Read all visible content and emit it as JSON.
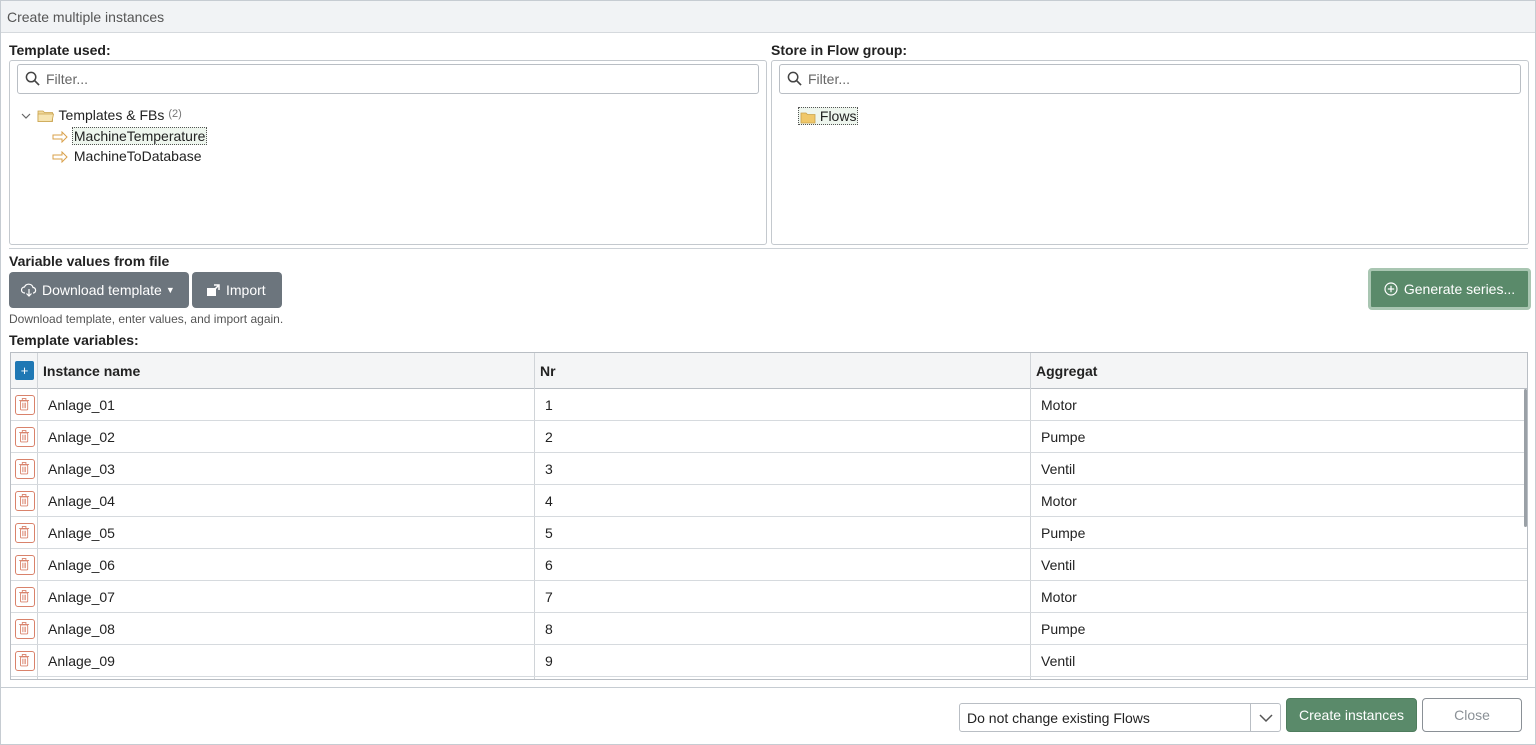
{
  "dialog": {
    "title": "Create multiple instances"
  },
  "template_section": {
    "label": "Template used:",
    "filter_placeholder": "Filter...",
    "tree": {
      "root_label": "Templates & FBs",
      "root_count": "(2)",
      "items": [
        "MachineTemperature",
        "MachineToDatabase"
      ],
      "selected": "MachineTemperature"
    }
  },
  "flow_section": {
    "label": "Store in Flow group:",
    "filter_placeholder": "Filter...",
    "tree": {
      "items": [
        "Flows"
      ]
    }
  },
  "variables_file": {
    "label": "Variable values from file",
    "download_label": "Download template",
    "import_label": "Import",
    "generate_label": "Generate series...",
    "hint": "Download template, enter values, and import again."
  },
  "template_vars": {
    "label": "Template variables:",
    "columns": [
      "Instance name",
      "Nr",
      "Aggregat"
    ],
    "rows": [
      [
        "Anlage_01",
        "1",
        "Motor"
      ],
      [
        "Anlage_02",
        "2",
        "Pumpe"
      ],
      [
        "Anlage_03",
        "3",
        "Ventil"
      ],
      [
        "Anlage_04",
        "4",
        "Motor"
      ],
      [
        "Anlage_05",
        "5",
        "Pumpe"
      ],
      [
        "Anlage_06",
        "6",
        "Ventil"
      ],
      [
        "Anlage_07",
        "7",
        "Motor"
      ],
      [
        "Anlage_08",
        "8",
        "Pumpe"
      ],
      [
        "Anlage_09",
        "9",
        "Ventil"
      ]
    ]
  },
  "footer": {
    "existing_flows_option": "Do not change existing Flows",
    "create_label": "Create instances",
    "close_label": "Close"
  },
  "colors": {
    "accent_green": "#5a8a6a",
    "button_gray": "#6c757d",
    "add_blue": "#1f78b4",
    "delete_red": "#d9826b"
  }
}
